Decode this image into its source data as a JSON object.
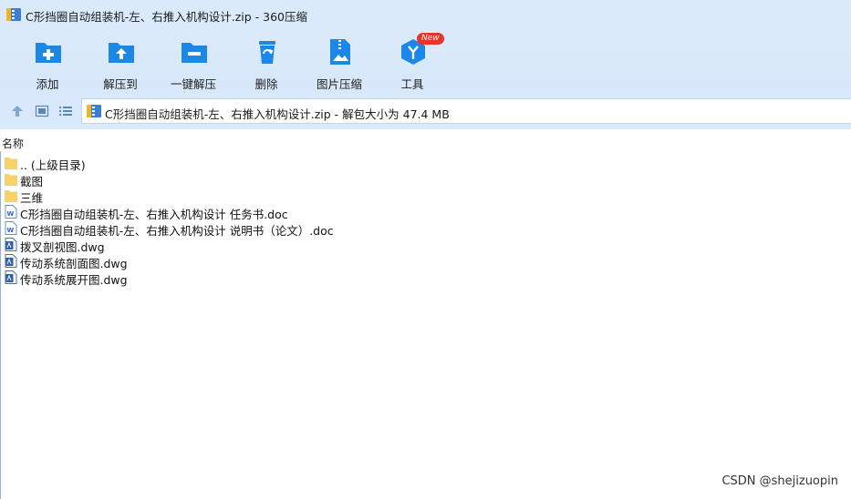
{
  "window": {
    "title": "C形挡圈自动组装机-左、右推入机构设计.zip - 360压缩"
  },
  "toolbar": {
    "items": [
      {
        "label": "添加",
        "icon": "add-folder-icon"
      },
      {
        "label": "解压到",
        "icon": "extract-to-icon"
      },
      {
        "label": "一键解压",
        "icon": "one-click-extract-icon"
      },
      {
        "label": "删除",
        "icon": "recycle-bin-icon"
      },
      {
        "label": "图片压缩",
        "icon": "image-compress-icon"
      },
      {
        "label": "工具",
        "icon": "tools-cube-icon",
        "badge": "New"
      }
    ]
  },
  "address": {
    "text": "C形挡圈自动组装机-左、右推入机构设计.zip - 解包大小为 47.4 MB"
  },
  "list": {
    "column_name": "名称",
    "files": [
      {
        "name": ".. (上级目录)",
        "type": "folder"
      },
      {
        "name": "截图",
        "type": "folder"
      },
      {
        "name": "三维",
        "type": "folder"
      },
      {
        "name": "C形挡圈自动组装机-左、右推入机构设计 任务书.doc",
        "type": "doc"
      },
      {
        "name": "C形挡圈自动组装机-左、右推入机构设计 说明书（论文）.doc",
        "type": "doc"
      },
      {
        "name": "拨叉剖视图.dwg",
        "type": "dwg"
      },
      {
        "name": "传动系统剖面图.dwg",
        "type": "dwg"
      },
      {
        "name": "传动系统展开图.dwg",
        "type": "dwg"
      }
    ]
  },
  "watermark": "CSDN @shejizuopin",
  "colors": {
    "accent": "#1b88e8",
    "toolbar_bg": "#dbeafb",
    "badge": "#e8352c",
    "folder": "#f6d26b"
  }
}
